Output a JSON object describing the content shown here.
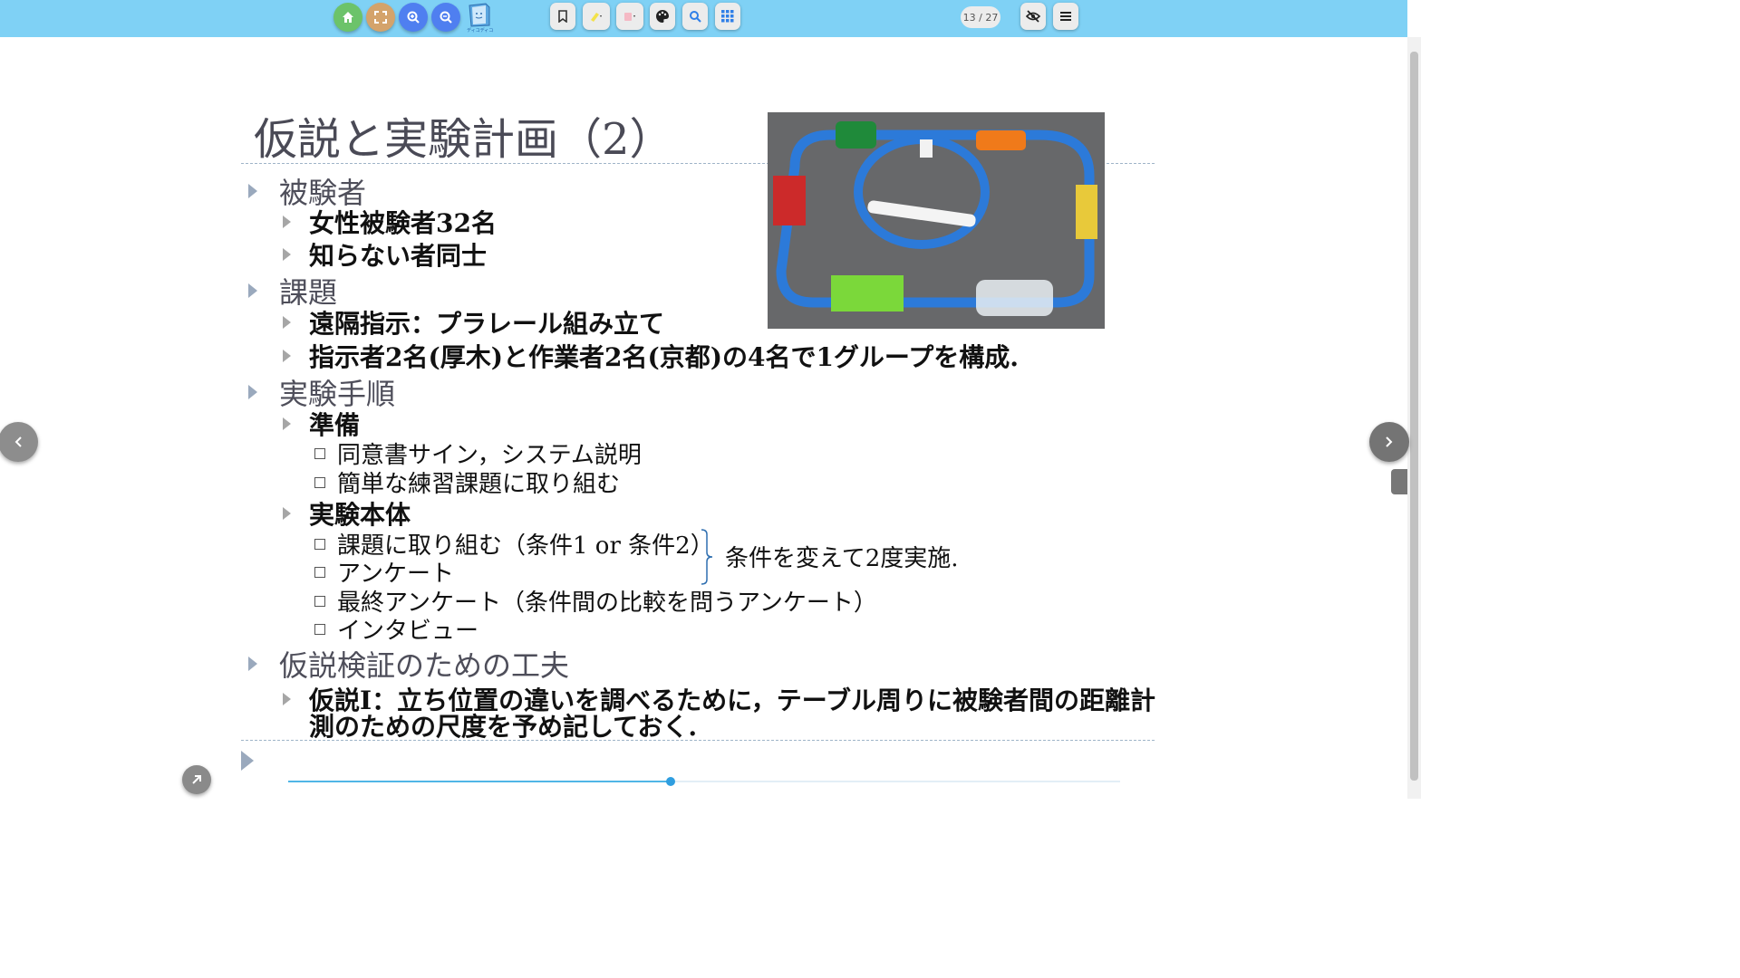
{
  "toolbar": {
    "page_indicator": "13 / 27",
    "logo_text": "ディコディコ",
    "colors": {
      "bar": "#7fd1f5",
      "home": "#6cc36a",
      "fullscreen": "#d4a36b",
      "zoom": "#4f7ff0"
    }
  },
  "slide": {
    "title": "仮説と実験計画（2）",
    "sections": [
      {
        "heading": "被験者",
        "items": [
          "女性被験者32名",
          "知らない者同士"
        ]
      },
      {
        "heading": "課題",
        "items": [
          "遠隔指示：プラレール組み立て",
          "指示者2名(厚木)と作業者2名(京都)の4名で1グループを構成."
        ]
      },
      {
        "heading": "実験手順",
        "groups": [
          {
            "label": "準備",
            "items": [
              "同意書サイン，システム説明",
              "簡単な練習課題に取り組む"
            ]
          },
          {
            "label": "実験本体",
            "items": [
              "課題に取り組む（条件1 or 条件2）",
              "アンケート",
              "最終アンケート（条件間の比較を問うアンケート）",
              "インタビュー"
            ]
          }
        ],
        "bracket_note": "条件を変えて2度実施."
      },
      {
        "heading": "仮説検証のための工夫",
        "items": [
          "仮説I：立ち位置の違いを調べるために，テーブル周りに被験者間の距離計",
          "測のための尺度を予め記しておく."
        ]
      }
    ]
  },
  "progress": {
    "value": 0.46
  }
}
